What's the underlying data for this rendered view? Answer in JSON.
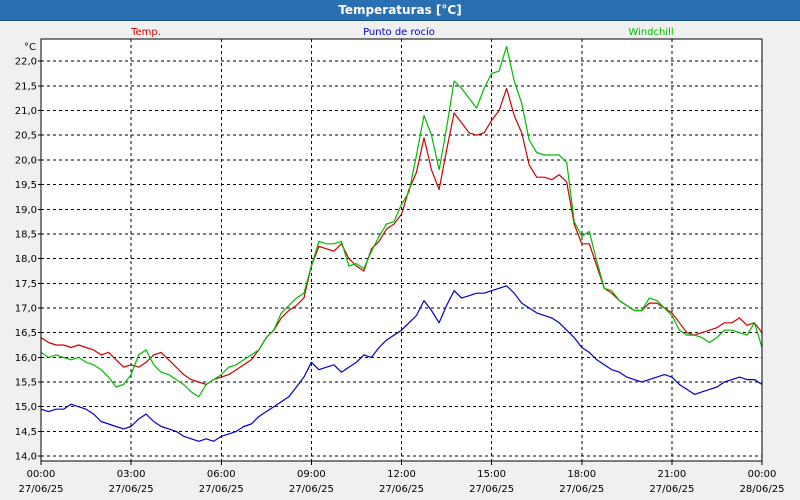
{
  "window": {
    "title": "Temperaturas [°C]"
  },
  "colors": {
    "background": "#ffffff",
    "frame": "#000000",
    "grid": "#000000",
    "temp": "#cc0000",
    "dew": "#0000cc",
    "windchill": "#00bb00",
    "titlebar": "#2b6fb3"
  },
  "chart_data": {
    "type": "line",
    "title": "",
    "unit_label": "°C",
    "ylim": [
      13.9,
      22.45
    ],
    "xlim": [
      0,
      24
    ],
    "grid": true,
    "legend_placement": "top",
    "y_ticks": [
      "14,0",
      "14,5",
      "15,0",
      "15,5",
      "16,0",
      "16,5",
      "17,0",
      "17,5",
      "18,0",
      "18,5",
      "19,0",
      "19,5",
      "20,0",
      "20,5",
      "21,0",
      "21,5",
      "22,0"
    ],
    "x_ticks": [
      {
        "time": "00:00",
        "date": "27/06/25"
      },
      {
        "time": "03:00",
        "date": "27/06/25"
      },
      {
        "time": "06:00",
        "date": "27/06/25"
      },
      {
        "time": "09:00",
        "date": "27/06/25"
      },
      {
        "time": "12:00",
        "date": "27/06/25"
      },
      {
        "time": "15:00",
        "date": "27/06/25"
      },
      {
        "time": "18:00",
        "date": "27/06/25"
      },
      {
        "time": "21:00",
        "date": "27/06/25"
      },
      {
        "time": "00:00",
        "date": "28/06/25"
      }
    ],
    "series": [
      {
        "name": "Temp.",
        "color": "#cc0000",
        "points": [
          [
            0,
            16.4
          ],
          [
            0.25,
            16.3
          ],
          [
            0.5,
            16.25
          ],
          [
            0.75,
            16.25
          ],
          [
            1,
            16.2
          ],
          [
            1.25,
            16.25
          ],
          [
            1.5,
            16.2
          ],
          [
            1.75,
            16.15
          ],
          [
            2,
            16.05
          ],
          [
            2.25,
            16.1
          ],
          [
            2.5,
            15.95
          ],
          [
            2.75,
            15.8
          ],
          [
            3,
            15.85
          ],
          [
            3.25,
            15.8
          ],
          [
            3.5,
            15.9
          ],
          [
            3.75,
            16.05
          ],
          [
            4,
            16.1
          ],
          [
            4.25,
            15.95
          ],
          [
            4.5,
            15.8
          ],
          [
            4.75,
            15.65
          ],
          [
            5,
            15.55
          ],
          [
            5.25,
            15.5
          ],
          [
            5.5,
            15.45
          ],
          [
            5.75,
            15.55
          ],
          [
            6,
            15.6
          ],
          [
            6.25,
            15.65
          ],
          [
            6.5,
            15.75
          ],
          [
            6.75,
            15.85
          ],
          [
            7,
            15.95
          ],
          [
            7.25,
            16.15
          ],
          [
            7.5,
            16.4
          ],
          [
            7.75,
            16.55
          ],
          [
            8,
            16.8
          ],
          [
            8.25,
            16.95
          ],
          [
            8.5,
            17.05
          ],
          [
            8.75,
            17.2
          ],
          [
            9,
            17.85
          ],
          [
            9.25,
            18.25
          ],
          [
            9.5,
            18.2
          ],
          [
            9.75,
            18.15
          ],
          [
            10,
            18.3
          ],
          [
            10.25,
            18.0
          ],
          [
            10.5,
            17.85
          ],
          [
            10.75,
            17.75
          ],
          [
            11,
            18.2
          ],
          [
            11.25,
            18.35
          ],
          [
            11.5,
            18.6
          ],
          [
            11.75,
            18.7
          ],
          [
            12,
            18.9
          ],
          [
            12.25,
            19.4
          ],
          [
            12.5,
            19.75
          ],
          [
            12.75,
            20.45
          ],
          [
            13,
            19.8
          ],
          [
            13.25,
            19.4
          ],
          [
            13.5,
            20.2
          ],
          [
            13.75,
            20.95
          ],
          [
            14,
            20.75
          ],
          [
            14.25,
            20.55
          ],
          [
            14.5,
            20.5
          ],
          [
            14.75,
            20.55
          ],
          [
            15,
            20.8
          ],
          [
            15.25,
            21.0
          ],
          [
            15.5,
            21.45
          ],
          [
            15.75,
            20.9
          ],
          [
            16,
            20.55
          ],
          [
            16.25,
            19.9
          ],
          [
            16.5,
            19.65
          ],
          [
            16.75,
            19.65
          ],
          [
            17,
            19.6
          ],
          [
            17.25,
            19.7
          ],
          [
            17.5,
            19.55
          ],
          [
            17.75,
            18.7
          ],
          [
            18,
            18.3
          ],
          [
            18.25,
            18.3
          ],
          [
            18.5,
            17.85
          ],
          [
            18.75,
            17.4
          ],
          [
            19,
            17.3
          ],
          [
            19.25,
            17.15
          ],
          [
            19.5,
            17.05
          ],
          [
            19.75,
            16.95
          ],
          [
            20,
            16.95
          ],
          [
            20.25,
            17.1
          ],
          [
            20.5,
            17.1
          ],
          [
            20.75,
            17.0
          ],
          [
            21,
            16.9
          ],
          [
            21.25,
            16.7
          ],
          [
            21.5,
            16.5
          ],
          [
            21.75,
            16.45
          ],
          [
            22,
            16.5
          ],
          [
            22.25,
            16.55
          ],
          [
            22.5,
            16.6
          ],
          [
            22.75,
            16.7
          ],
          [
            23,
            16.7
          ],
          [
            23.25,
            16.8
          ],
          [
            23.5,
            16.65
          ],
          [
            23.75,
            16.7
          ],
          [
            24,
            16.5
          ]
        ]
      },
      {
        "name": "Punto de rocío",
        "color": "#0000cc",
        "points": [
          [
            0,
            14.95
          ],
          [
            0.25,
            14.9
          ],
          [
            0.5,
            14.95
          ],
          [
            0.75,
            14.95
          ],
          [
            1,
            15.05
          ],
          [
            1.25,
            15.0
          ],
          [
            1.5,
            14.95
          ],
          [
            1.75,
            14.85
          ],
          [
            2,
            14.7
          ],
          [
            2.25,
            14.65
          ],
          [
            2.5,
            14.6
          ],
          [
            2.75,
            14.55
          ],
          [
            3,
            14.6
          ],
          [
            3.25,
            14.75
          ],
          [
            3.5,
            14.85
          ],
          [
            3.75,
            14.7
          ],
          [
            4,
            14.6
          ],
          [
            4.25,
            14.55
          ],
          [
            4.5,
            14.5
          ],
          [
            4.75,
            14.4
          ],
          [
            5,
            14.35
          ],
          [
            5.25,
            14.3
          ],
          [
            5.5,
            14.35
          ],
          [
            5.75,
            14.3
          ],
          [
            6,
            14.4
          ],
          [
            6.25,
            14.45
          ],
          [
            6.5,
            14.5
          ],
          [
            6.75,
            14.6
          ],
          [
            7,
            14.65
          ],
          [
            7.25,
            14.8
          ],
          [
            7.5,
            14.9
          ],
          [
            7.75,
            15.0
          ],
          [
            8,
            15.1
          ],
          [
            8.25,
            15.2
          ],
          [
            8.5,
            15.4
          ],
          [
            8.75,
            15.6
          ],
          [
            9,
            15.9
          ],
          [
            9.25,
            15.75
          ],
          [
            9.5,
            15.8
          ],
          [
            9.75,
            15.85
          ],
          [
            10,
            15.7
          ],
          [
            10.25,
            15.8
          ],
          [
            10.5,
            15.9
          ],
          [
            10.75,
            16.05
          ],
          [
            11,
            16.0
          ],
          [
            11.25,
            16.2
          ],
          [
            11.5,
            16.35
          ],
          [
            11.75,
            16.45
          ],
          [
            12,
            16.55
          ],
          [
            12.25,
            16.7
          ],
          [
            12.5,
            16.85
          ],
          [
            12.75,
            17.15
          ],
          [
            13,
            16.95
          ],
          [
            13.25,
            16.7
          ],
          [
            13.5,
            17.05
          ],
          [
            13.75,
            17.35
          ],
          [
            14,
            17.2
          ],
          [
            14.25,
            17.25
          ],
          [
            14.5,
            17.3
          ],
          [
            14.75,
            17.3
          ],
          [
            15,
            17.35
          ],
          [
            15.25,
            17.4
          ],
          [
            15.5,
            17.45
          ],
          [
            15.75,
            17.3
          ],
          [
            16,
            17.1
          ],
          [
            16.25,
            17.0
          ],
          [
            16.5,
            16.9
          ],
          [
            16.75,
            16.85
          ],
          [
            17,
            16.8
          ],
          [
            17.25,
            16.7
          ],
          [
            17.5,
            16.55
          ],
          [
            17.75,
            16.4
          ],
          [
            18,
            16.2
          ],
          [
            18.25,
            16.1
          ],
          [
            18.5,
            15.95
          ],
          [
            18.75,
            15.85
          ],
          [
            19,
            15.75
          ],
          [
            19.25,
            15.7
          ],
          [
            19.5,
            15.6
          ],
          [
            19.75,
            15.55
          ],
          [
            20,
            15.5
          ],
          [
            20.25,
            15.55
          ],
          [
            20.5,
            15.6
          ],
          [
            20.75,
            15.65
          ],
          [
            21,
            15.6
          ],
          [
            21.25,
            15.45
          ],
          [
            21.5,
            15.35
          ],
          [
            21.75,
            15.25
          ],
          [
            22,
            15.3
          ],
          [
            22.25,
            15.35
          ],
          [
            22.5,
            15.4
          ],
          [
            22.75,
            15.5
          ],
          [
            23,
            15.55
          ],
          [
            23.25,
            15.6
          ],
          [
            23.5,
            15.55
          ],
          [
            23.75,
            15.55
          ],
          [
            24,
            15.45
          ]
        ]
      },
      {
        "name": "Windchill",
        "color": "#00bb00",
        "points": [
          [
            0,
            16.1
          ],
          [
            0.25,
            16.0
          ],
          [
            0.5,
            16.05
          ],
          [
            0.75,
            16.0
          ],
          [
            1,
            15.95
          ],
          [
            1.25,
            16.0
          ],
          [
            1.5,
            15.9
          ],
          [
            1.75,
            15.85
          ],
          [
            2,
            15.75
          ],
          [
            2.25,
            15.6
          ],
          [
            2.5,
            15.4
          ],
          [
            2.75,
            15.45
          ],
          [
            3,
            15.65
          ],
          [
            3.25,
            16.05
          ],
          [
            3.5,
            16.15
          ],
          [
            3.75,
            15.85
          ],
          [
            4,
            15.7
          ],
          [
            4.25,
            15.65
          ],
          [
            4.5,
            15.55
          ],
          [
            4.75,
            15.45
          ],
          [
            5,
            15.3
          ],
          [
            5.25,
            15.2
          ],
          [
            5.5,
            15.45
          ],
          [
            5.75,
            15.55
          ],
          [
            6,
            15.65
          ],
          [
            6.25,
            15.8
          ],
          [
            6.5,
            15.85
          ],
          [
            6.75,
            15.95
          ],
          [
            7,
            16.05
          ],
          [
            7.25,
            16.15
          ],
          [
            7.5,
            16.4
          ],
          [
            7.75,
            16.55
          ],
          [
            8,
            16.9
          ],
          [
            8.25,
            17.05
          ],
          [
            8.5,
            17.2
          ],
          [
            8.75,
            17.3
          ],
          [
            9,
            17.85
          ],
          [
            9.25,
            18.35
          ],
          [
            9.5,
            18.3
          ],
          [
            9.75,
            18.3
          ],
          [
            10,
            18.35
          ],
          [
            10.25,
            17.85
          ],
          [
            10.5,
            17.9
          ],
          [
            10.75,
            17.8
          ],
          [
            11,
            18.15
          ],
          [
            11.25,
            18.45
          ],
          [
            11.5,
            18.7
          ],
          [
            11.75,
            18.75
          ],
          [
            12,
            19.1
          ],
          [
            12.25,
            19.35
          ],
          [
            12.5,
            20.1
          ],
          [
            12.75,
            20.9
          ],
          [
            13,
            20.5
          ],
          [
            13.25,
            19.8
          ],
          [
            13.5,
            20.65
          ],
          [
            13.75,
            21.6
          ],
          [
            14,
            21.45
          ],
          [
            14.25,
            21.25
          ],
          [
            14.5,
            21.05
          ],
          [
            14.75,
            21.45
          ],
          [
            15,
            21.75
          ],
          [
            15.25,
            21.8
          ],
          [
            15.5,
            22.3
          ],
          [
            15.75,
            21.6
          ],
          [
            16,
            21.15
          ],
          [
            16.25,
            20.4
          ],
          [
            16.5,
            20.15
          ],
          [
            16.75,
            20.1
          ],
          [
            17,
            20.1
          ],
          [
            17.25,
            20.1
          ],
          [
            17.5,
            19.95
          ],
          [
            17.75,
            18.75
          ],
          [
            18,
            18.45
          ],
          [
            18.25,
            18.55
          ],
          [
            18.5,
            17.95
          ],
          [
            18.75,
            17.4
          ],
          [
            19,
            17.35
          ],
          [
            19.25,
            17.15
          ],
          [
            19.5,
            17.05
          ],
          [
            19.75,
            16.95
          ],
          [
            20,
            16.95
          ],
          [
            20.25,
            17.2
          ],
          [
            20.5,
            17.15
          ],
          [
            20.75,
            17.0
          ],
          [
            21,
            16.85
          ],
          [
            21.25,
            16.55
          ],
          [
            21.5,
            16.45
          ],
          [
            21.75,
            16.45
          ],
          [
            22,
            16.4
          ],
          [
            22.25,
            16.3
          ],
          [
            22.5,
            16.4
          ],
          [
            22.75,
            16.55
          ],
          [
            23,
            16.55
          ],
          [
            23.25,
            16.5
          ],
          [
            23.5,
            16.45
          ],
          [
            23.75,
            16.7
          ],
          [
            24,
            16.2
          ]
        ]
      }
    ]
  }
}
